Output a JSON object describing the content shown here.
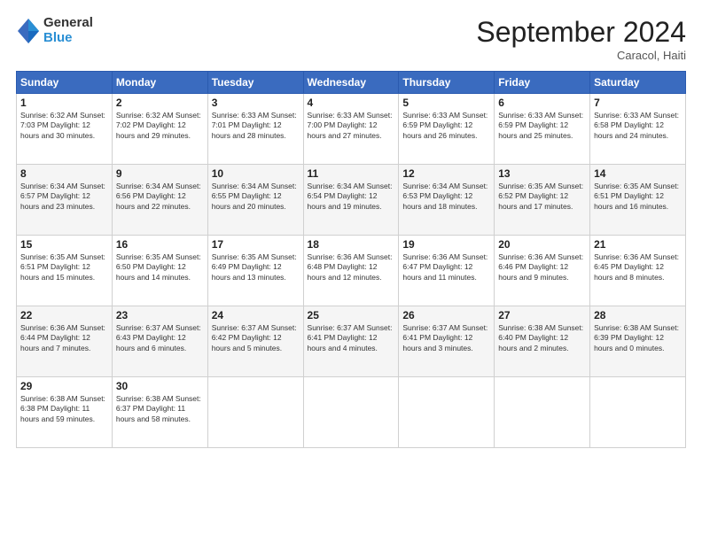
{
  "logo": {
    "line1": "General",
    "line2": "Blue"
  },
  "title": "September 2024",
  "subtitle": "Caracol, Haiti",
  "weekdays": [
    "Sunday",
    "Monday",
    "Tuesday",
    "Wednesday",
    "Thursday",
    "Friday",
    "Saturday"
  ],
  "weeks": [
    [
      {
        "day": "1",
        "info": "Sunrise: 6:32 AM\nSunset: 7:03 PM\nDaylight: 12 hours\nand 30 minutes."
      },
      {
        "day": "2",
        "info": "Sunrise: 6:32 AM\nSunset: 7:02 PM\nDaylight: 12 hours\nand 29 minutes."
      },
      {
        "day": "3",
        "info": "Sunrise: 6:33 AM\nSunset: 7:01 PM\nDaylight: 12 hours\nand 28 minutes."
      },
      {
        "day": "4",
        "info": "Sunrise: 6:33 AM\nSunset: 7:00 PM\nDaylight: 12 hours\nand 27 minutes."
      },
      {
        "day": "5",
        "info": "Sunrise: 6:33 AM\nSunset: 6:59 PM\nDaylight: 12 hours\nand 26 minutes."
      },
      {
        "day": "6",
        "info": "Sunrise: 6:33 AM\nSunset: 6:59 PM\nDaylight: 12 hours\nand 25 minutes."
      },
      {
        "day": "7",
        "info": "Sunrise: 6:33 AM\nSunset: 6:58 PM\nDaylight: 12 hours\nand 24 minutes."
      }
    ],
    [
      {
        "day": "8",
        "info": "Sunrise: 6:34 AM\nSunset: 6:57 PM\nDaylight: 12 hours\nand 23 minutes."
      },
      {
        "day": "9",
        "info": "Sunrise: 6:34 AM\nSunset: 6:56 PM\nDaylight: 12 hours\nand 22 minutes."
      },
      {
        "day": "10",
        "info": "Sunrise: 6:34 AM\nSunset: 6:55 PM\nDaylight: 12 hours\nand 20 minutes."
      },
      {
        "day": "11",
        "info": "Sunrise: 6:34 AM\nSunset: 6:54 PM\nDaylight: 12 hours\nand 19 minutes."
      },
      {
        "day": "12",
        "info": "Sunrise: 6:34 AM\nSunset: 6:53 PM\nDaylight: 12 hours\nand 18 minutes."
      },
      {
        "day": "13",
        "info": "Sunrise: 6:35 AM\nSunset: 6:52 PM\nDaylight: 12 hours\nand 17 minutes."
      },
      {
        "day": "14",
        "info": "Sunrise: 6:35 AM\nSunset: 6:51 PM\nDaylight: 12 hours\nand 16 minutes."
      }
    ],
    [
      {
        "day": "15",
        "info": "Sunrise: 6:35 AM\nSunset: 6:51 PM\nDaylight: 12 hours\nand 15 minutes."
      },
      {
        "day": "16",
        "info": "Sunrise: 6:35 AM\nSunset: 6:50 PM\nDaylight: 12 hours\nand 14 minutes."
      },
      {
        "day": "17",
        "info": "Sunrise: 6:35 AM\nSunset: 6:49 PM\nDaylight: 12 hours\nand 13 minutes."
      },
      {
        "day": "18",
        "info": "Sunrise: 6:36 AM\nSunset: 6:48 PM\nDaylight: 12 hours\nand 12 minutes."
      },
      {
        "day": "19",
        "info": "Sunrise: 6:36 AM\nSunset: 6:47 PM\nDaylight: 12 hours\nand 11 minutes."
      },
      {
        "day": "20",
        "info": "Sunrise: 6:36 AM\nSunset: 6:46 PM\nDaylight: 12 hours\nand 9 minutes."
      },
      {
        "day": "21",
        "info": "Sunrise: 6:36 AM\nSunset: 6:45 PM\nDaylight: 12 hours\nand 8 minutes."
      }
    ],
    [
      {
        "day": "22",
        "info": "Sunrise: 6:36 AM\nSunset: 6:44 PM\nDaylight: 12 hours\nand 7 minutes."
      },
      {
        "day": "23",
        "info": "Sunrise: 6:37 AM\nSunset: 6:43 PM\nDaylight: 12 hours\nand 6 minutes."
      },
      {
        "day": "24",
        "info": "Sunrise: 6:37 AM\nSunset: 6:42 PM\nDaylight: 12 hours\nand 5 minutes."
      },
      {
        "day": "25",
        "info": "Sunrise: 6:37 AM\nSunset: 6:41 PM\nDaylight: 12 hours\nand 4 minutes."
      },
      {
        "day": "26",
        "info": "Sunrise: 6:37 AM\nSunset: 6:41 PM\nDaylight: 12 hours\nand 3 minutes."
      },
      {
        "day": "27",
        "info": "Sunrise: 6:38 AM\nSunset: 6:40 PM\nDaylight: 12 hours\nand 2 minutes."
      },
      {
        "day": "28",
        "info": "Sunrise: 6:38 AM\nSunset: 6:39 PM\nDaylight: 12 hours\nand 0 minutes."
      }
    ],
    [
      {
        "day": "29",
        "info": "Sunrise: 6:38 AM\nSunset: 6:38 PM\nDaylight: 11 hours\nand 59 minutes."
      },
      {
        "day": "30",
        "info": "Sunrise: 6:38 AM\nSunset: 6:37 PM\nDaylight: 11 hours\nand 58 minutes."
      },
      {
        "day": "",
        "info": ""
      },
      {
        "day": "",
        "info": ""
      },
      {
        "day": "",
        "info": ""
      },
      {
        "day": "",
        "info": ""
      },
      {
        "day": "",
        "info": ""
      }
    ]
  ]
}
